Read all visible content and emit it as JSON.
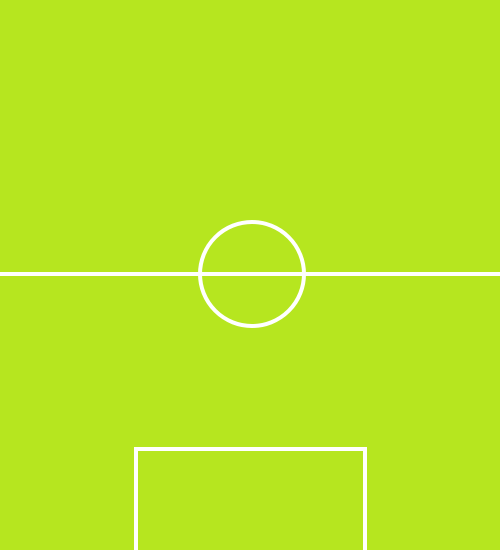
{
  "field": {
    "surface_color": "#b6e61f",
    "line_color": "#ffffff",
    "markings": [
      "halfway-line",
      "center-circle",
      "penalty-box"
    ]
  }
}
